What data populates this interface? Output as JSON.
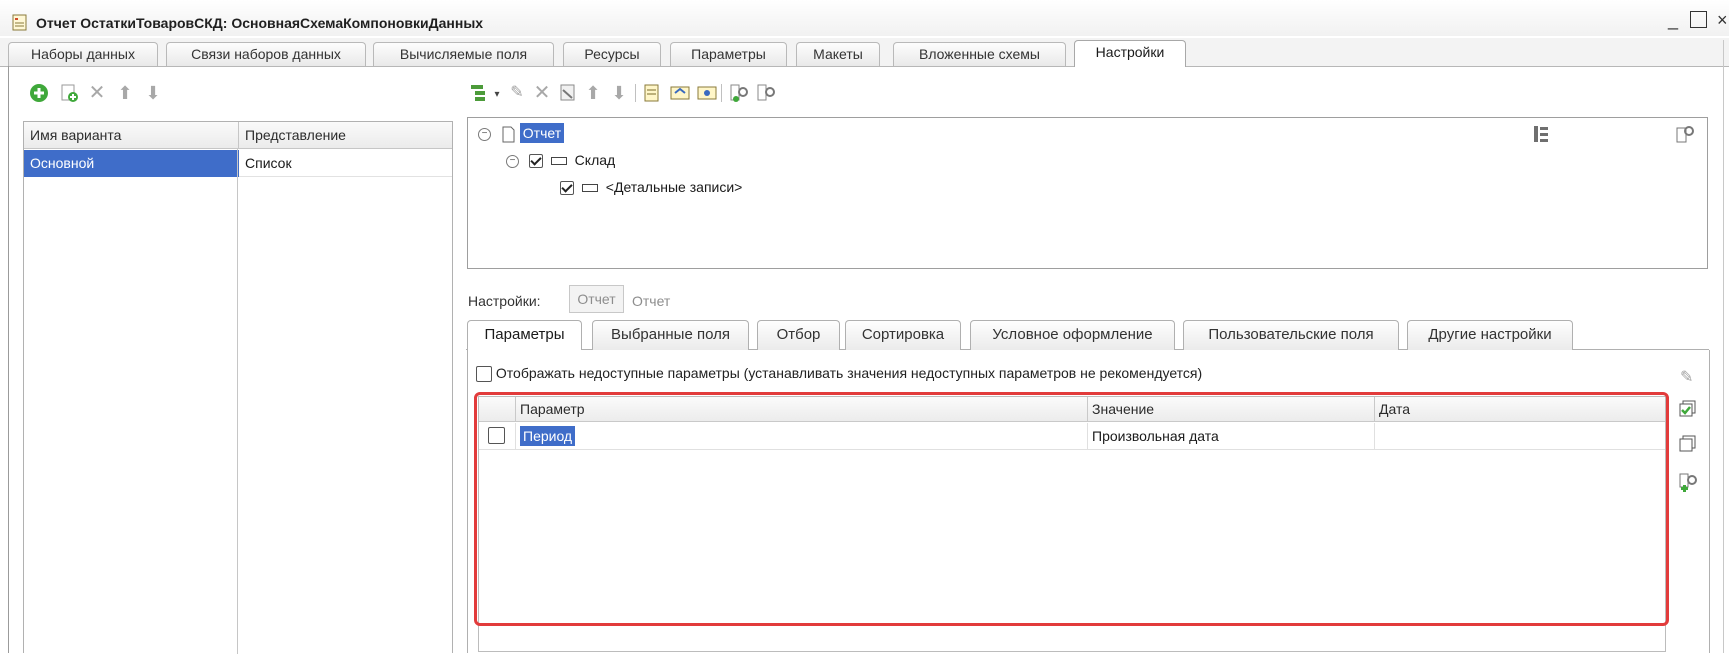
{
  "window": {
    "title": "Отчет ОстаткиТоваровСКД: ОсновнаяСхемаКомпоновкиДанных",
    "minimize": "_",
    "close": "×"
  },
  "tabs": [
    {
      "label": "Наборы данных"
    },
    {
      "label": "Связи наборов данных"
    },
    {
      "label": "Вычисляемые поля"
    },
    {
      "label": "Ресурсы"
    },
    {
      "label": "Параметры"
    },
    {
      "label": "Макеты"
    },
    {
      "label": "Вложенные схемы"
    },
    {
      "label": "Настройки",
      "active": true
    }
  ],
  "variants": {
    "columns": [
      "Имя варианта",
      "Представление"
    ],
    "rows": [
      {
        "name": "Основной",
        "presentation": "Список"
      }
    ]
  },
  "tree": {
    "root": "Отчет",
    "group": "Склад",
    "detail": "<Детальные записи>"
  },
  "settings": {
    "label": "Настройки:",
    "chip1": "Отчет",
    "chip2": "Отчет"
  },
  "inner_tabs": [
    {
      "label": "Параметры",
      "active": true
    },
    {
      "label": "Выбранные поля"
    },
    {
      "label": "Отбор"
    },
    {
      "label": "Сортировка"
    },
    {
      "label": "Условное оформление"
    },
    {
      "label": "Пользовательские поля"
    },
    {
      "label": "Другие настройки"
    }
  ],
  "params": {
    "show_unavailable_label": "Отображать недоступные параметры (устанавливать значения недоступных параметров не рекомендуется)",
    "columns": [
      "Параметр",
      "Значение",
      "Дата"
    ],
    "rows": [
      {
        "checked": false,
        "param": "Период",
        "value": "Произвольная дата",
        "date": ""
      }
    ]
  },
  "colors": {
    "selection": "#3f6dc9",
    "highlight_frame": "#e23b3b",
    "add_green": "#3fa83a"
  }
}
